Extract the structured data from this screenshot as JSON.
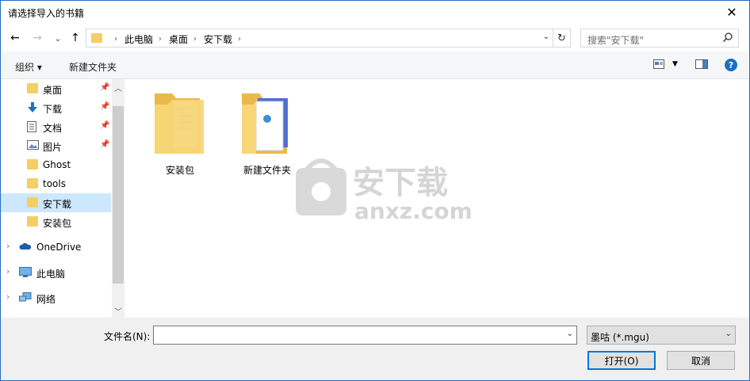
{
  "window": {
    "title": "请选择导入的书籍",
    "close_symbol": "✕"
  },
  "nav": {
    "back_symbol": "←",
    "forward_symbol": "→",
    "recent_symbol": "⌄",
    "up_symbol": "↑",
    "breadcrumb": [
      "此电脑",
      "桌面",
      "安下载"
    ],
    "search_placeholder": "搜索\"安下载\""
  },
  "toolbar": {
    "organize": "组织 ▾",
    "new_folder": "新建文件夹"
  },
  "sidebar": {
    "quick_access": [
      {
        "label": "桌面",
        "icon": "folder-icon",
        "pinned": true
      },
      {
        "label": "下载",
        "icon": "download-arrow-icon",
        "pinned": true
      },
      {
        "label": "文档",
        "icon": "document-icon",
        "pinned": true
      },
      {
        "label": "图片",
        "icon": "picture-icon",
        "pinned": true
      },
      {
        "label": "Ghost",
        "icon": "folder-icon",
        "pinned": false
      },
      {
        "label": "tools",
        "icon": "folder-icon",
        "pinned": false
      },
      {
        "label": "安下载",
        "icon": "folder-icon",
        "pinned": false,
        "selected": true
      },
      {
        "label": "安装包",
        "icon": "folder-icon",
        "pinned": false
      }
    ],
    "roots": [
      {
        "label": "OneDrive",
        "icon": "cloud-icon"
      },
      {
        "label": "此电脑",
        "icon": "computer-icon"
      },
      {
        "label": "网络",
        "icon": "network-icon"
      }
    ]
  },
  "files": [
    {
      "name": "安装包",
      "icon": "folder-with-documents-icon"
    },
    {
      "name": "新建文件夹",
      "icon": "folder-with-app-icon"
    }
  ],
  "watermark": {
    "brand": "安下载",
    "domain": "anxz.com"
  },
  "bottom": {
    "filename_label": "文件名(N):",
    "filename_value": "",
    "filetype": "墨咕 (*.mgu)",
    "open_button": "打开(O)",
    "cancel_button": "取消"
  },
  "colors": {
    "accent": "#0078d7",
    "selection": "#cce8ff",
    "folder": "#f5cf64"
  }
}
